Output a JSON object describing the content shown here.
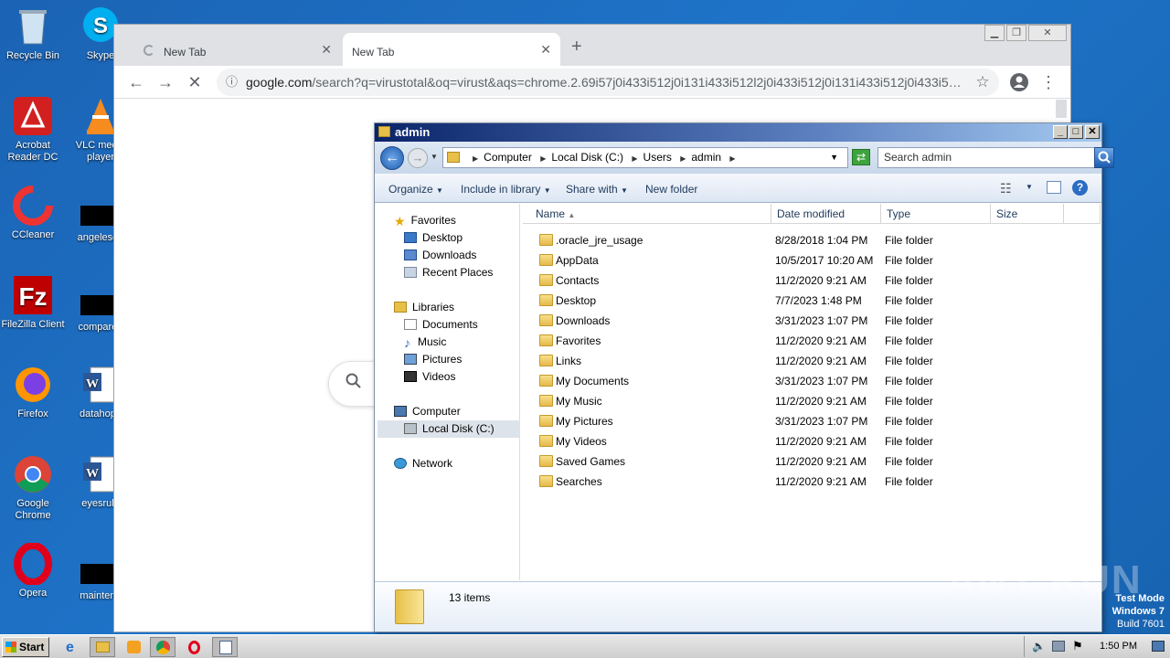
{
  "desktop": {
    "icons": [
      {
        "label": "Recycle Bin"
      },
      {
        "label": "Skype"
      },
      {
        "label": "Acrobat Reader DC"
      },
      {
        "label": "VLC media player"
      },
      {
        "label": "CCleaner"
      },
      {
        "label": "angelesob"
      },
      {
        "label": "FileZilla Client"
      },
      {
        "label": "compareb"
      },
      {
        "label": "Firefox"
      },
      {
        "label": "datahope"
      },
      {
        "label": "Google Chrome"
      },
      {
        "label": "eyesrule"
      },
      {
        "label": "Opera"
      },
      {
        "label": "maintena"
      }
    ]
  },
  "chrome": {
    "tabs": [
      {
        "title": "New Tab"
      },
      {
        "title": "New Tab"
      }
    ],
    "new_tab_symbol": "+",
    "address": {
      "host": "google.com",
      "rest": "/search?q=virustotal&oq=virust&aqs=chrome.2.69i57j0i433i512j0i131i433i512l2j0i433i512j0i131i433i512j0i433i5…"
    }
  },
  "explorer": {
    "title": "admin",
    "breadcrumb": [
      "Computer",
      "Local Disk (C:)",
      "Users",
      "admin"
    ],
    "search_placeholder": "Search admin",
    "commands": [
      "Organize",
      "Include in library",
      "Share with",
      "New folder"
    ],
    "nav": {
      "favorites": {
        "label": "Favorites",
        "items": [
          "Desktop",
          "Downloads",
          "Recent Places"
        ]
      },
      "libraries": {
        "label": "Libraries",
        "items": [
          "Documents",
          "Music",
          "Pictures",
          "Videos"
        ]
      },
      "computer": {
        "label": "Computer",
        "items": [
          "Local Disk (C:)"
        ]
      },
      "network": {
        "label": "Network"
      }
    },
    "columns": {
      "name": "Name",
      "date": "Date modified",
      "type": "Type",
      "size": "Size"
    },
    "rows": [
      {
        "name": ".oracle_jre_usage",
        "date": "8/28/2018 1:04 PM",
        "type": "File folder"
      },
      {
        "name": "AppData",
        "date": "10/5/2017 10:20 AM",
        "type": "File folder"
      },
      {
        "name": "Contacts",
        "date": "11/2/2020 9:21 AM",
        "type": "File folder"
      },
      {
        "name": "Desktop",
        "date": "7/7/2023 1:48 PM",
        "type": "File folder"
      },
      {
        "name": "Downloads",
        "date": "3/31/2023 1:07 PM",
        "type": "File folder"
      },
      {
        "name": "Favorites",
        "date": "11/2/2020 9:21 AM",
        "type": "File folder"
      },
      {
        "name": "Links",
        "date": "11/2/2020 9:21 AM",
        "type": "File folder"
      },
      {
        "name": "My Documents",
        "date": "3/31/2023 1:07 PM",
        "type": "File folder"
      },
      {
        "name": "My Music",
        "date": "11/2/2020 9:21 AM",
        "type": "File folder"
      },
      {
        "name": "My Pictures",
        "date": "3/31/2023 1:07 PM",
        "type": "File folder"
      },
      {
        "name": "My Videos",
        "date": "11/2/2020 9:21 AM",
        "type": "File folder"
      },
      {
        "name": "Saved Games",
        "date": "11/2/2020 9:21 AM",
        "type": "File folder"
      },
      {
        "name": "Searches",
        "date": "11/2/2020 9:21 AM",
        "type": "File folder"
      }
    ],
    "status": "13 items"
  },
  "taskbar": {
    "start_label": "Start",
    "clock": "1:50 PM"
  },
  "overlay": {
    "watermark": "ANY RUN",
    "test_mode": "Test Mode",
    "os": "Windows 7",
    "build": "Build 7601"
  }
}
